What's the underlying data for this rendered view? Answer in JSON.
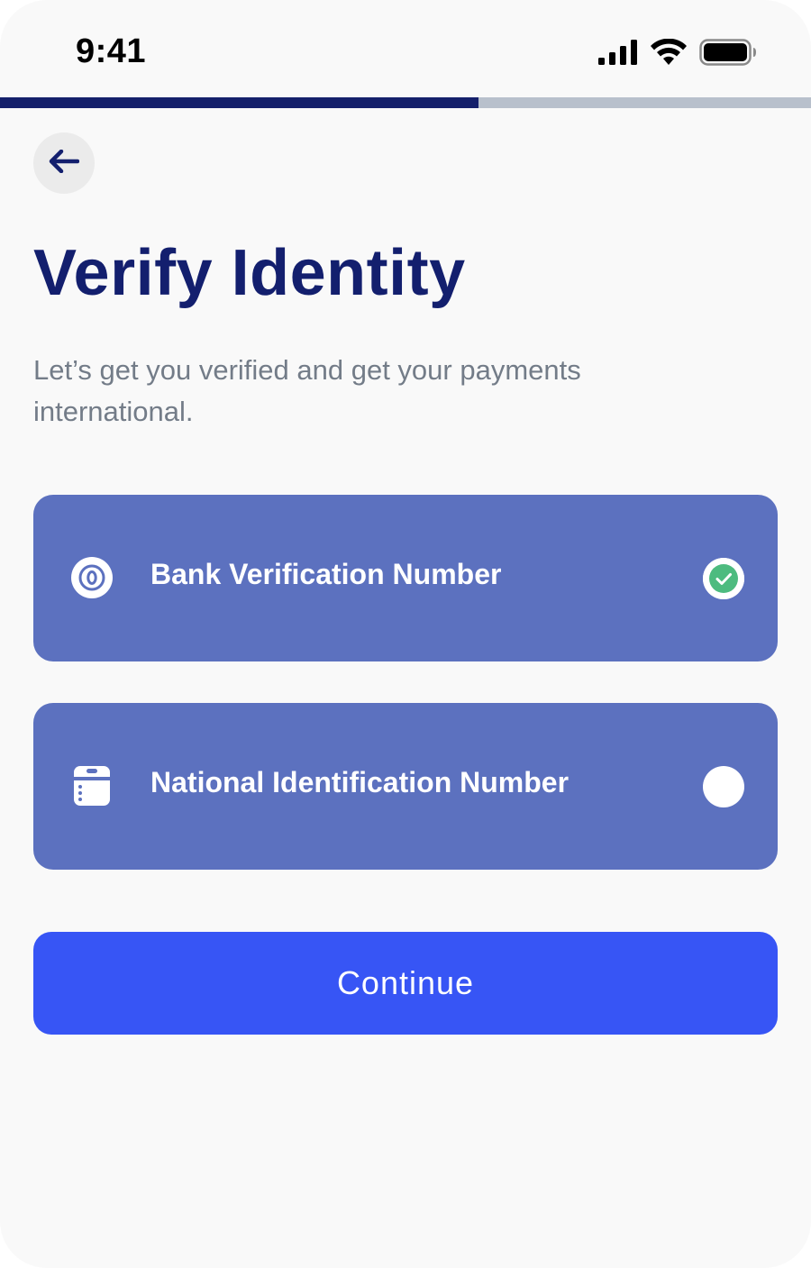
{
  "status_bar": {
    "time": "9:41",
    "icons": [
      "cellular-signal-icon",
      "wifi-icon",
      "battery-icon"
    ]
  },
  "progress": {
    "fraction": 0.59,
    "fill_color": "#15206b",
    "track_color": "#b8c0cc"
  },
  "header": {
    "back_icon": "arrow-left-icon",
    "title": "Verify Identity",
    "subtitle": "Let’s get you verified and get your payments international."
  },
  "options": [
    {
      "label": "Bank Verification Number",
      "icon": "bank-token-icon",
      "selected": true
    },
    {
      "label": "National Identification Number",
      "icon": "id-card-icon",
      "selected": false
    }
  ],
  "actions": {
    "continue_label": "Continue"
  },
  "colors": {
    "title": "#131f6e",
    "card": "#5c71bf",
    "primary_button": "#3755f5",
    "check": "#4dbb7f"
  }
}
